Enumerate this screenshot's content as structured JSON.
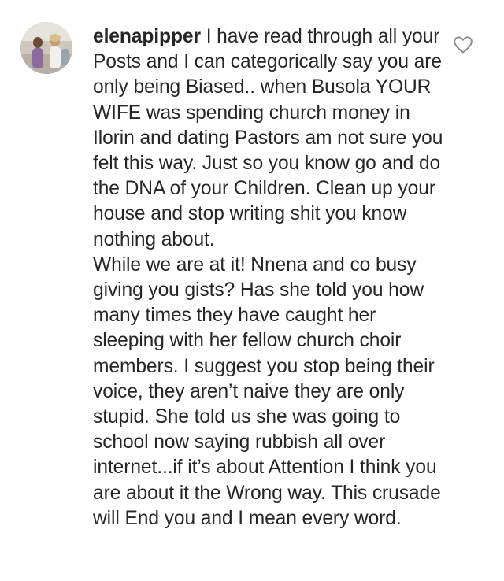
{
  "comment": {
    "username": "elenapipper",
    "body": "I have read through all your Posts and I can categorically say you are only being Biased.. when Busola YOUR WIFE was spending church money in Ilorin and dating Pastors am not sure you felt this way. Just so you know go and do the DNA of your Children. Clean up your house and stop writing shit you know nothing about.",
    "body_continued": "While we are at it! Nnena and co busy giving you gists? Has she told you how many times they have caught her sleeping with her fellow church choir members. I suggest you stop being their voice, they aren’t naive they are only stupid. She told us she was going to school now saying rubbish all over internet...if it’s about Attention I think you are about it the Wrong way. This crusade will End you and I mean every word."
  },
  "icons": {
    "avatar": "profile-photo",
    "like": "heart-outline-icon"
  },
  "colors": {
    "text": "#262626",
    "icon": "#8e8e8e",
    "background": "#ffffff"
  }
}
